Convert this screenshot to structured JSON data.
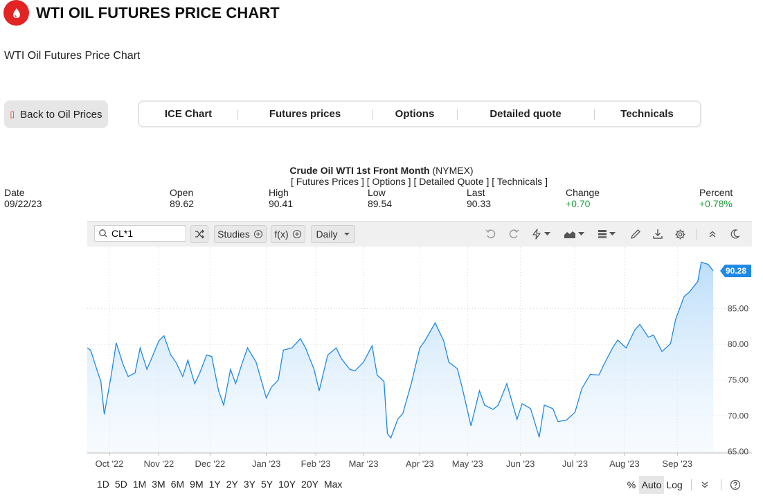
{
  "header": {
    "title": "WTI OIL FUTURES PRICE CHART",
    "subtitle": "WTI Oil Futures Price Chart",
    "logo_icon": "oil-drop-icon",
    "brand_color": "#e32424"
  },
  "back_button": {
    "label": "Back to Oil Prices",
    "icon": "back-box-icon"
  },
  "tabs": [
    {
      "label": "ICE Chart"
    },
    {
      "label": "Futures prices"
    },
    {
      "label": "Options"
    },
    {
      "label": "Detailed quote"
    },
    {
      "label": "Technicals"
    }
  ],
  "quote": {
    "name": "Crude Oil WTI 1st Front Month",
    "exchange": "(NYMEX)",
    "links": [
      "[ Futures Prices ]",
      "[ Options ]",
      "[ Detailed Quote ]",
      "[ Technicals ]"
    ],
    "columns": [
      {
        "label": "Date",
        "value": "09/22/23"
      },
      {
        "label": "Open",
        "value": "89.62"
      },
      {
        "label": "High",
        "value": "90.41"
      },
      {
        "label": "Low",
        "value": "89.54"
      },
      {
        "label": "Last",
        "value": "90.33"
      },
      {
        "label": "Change",
        "value": "+0.70"
      },
      {
        "label": "Percent",
        "value": "+0.78%"
      }
    ],
    "positive_color": "#1f9d3a"
  },
  "toolbar": {
    "search_value": "CL*1",
    "studies_label": "Studies",
    "fx_label": "f(x)",
    "interval_label": "Daily",
    "icons": [
      "search-icon",
      "shuffle-icon",
      "undo-icon",
      "redo-icon",
      "lightning-icon",
      "chart-type-icon",
      "layout-icon",
      "draw-pencil-icon",
      "download-icon",
      "settings-gear-icon",
      "collapse-up-icon",
      "dark-mode-moon-icon"
    ]
  },
  "ranges": [
    "1D",
    "5D",
    "1M",
    "3M",
    "6M",
    "9M",
    "1Y",
    "2Y",
    "3Y",
    "5Y",
    "10Y",
    "20Y",
    "Max"
  ],
  "scale_options": {
    "percent": "%",
    "auto": "Auto",
    "log": "Log"
  },
  "chart_data": {
    "type": "area",
    "title": "",
    "xlabel": "",
    "ylabel": "",
    "ylim": [
      64.8,
      93.0
    ],
    "yticks": [
      "65.00",
      "70.00",
      "75.00",
      "80.00",
      "85.00"
    ],
    "xticks": [
      {
        "label": "Oct '22",
        "date": "2022-10-03"
      },
      {
        "label": "Nov '22",
        "date": "2022-11-01"
      },
      {
        "label": "Dec '22",
        "date": "2022-12-01"
      },
      {
        "label": "Jan '23",
        "date": "2023-01-03"
      },
      {
        "label": "Feb '23",
        "date": "2023-02-01"
      },
      {
        "label": "Mar '23",
        "date": "2023-03-01"
      },
      {
        "label": "Apr '23",
        "date": "2023-04-03"
      },
      {
        "label": "May '23",
        "date": "2023-05-01"
      },
      {
        "label": "Jun '23",
        "date": "2023-06-01"
      },
      {
        "label": "Jul '23",
        "date": "2023-07-03"
      },
      {
        "label": "Aug '23",
        "date": "2023-08-01"
      },
      {
        "label": "Sep '23",
        "date": "2023-09-01"
      }
    ],
    "last_value_label": "90.28",
    "line_color": "#1e88e5",
    "fill_color": "#cfe6fb",
    "grid": true,
    "series": [
      {
        "x": [
          "2022-09-20",
          "2022-09-22",
          "2022-09-26",
          "2022-09-28",
          "2022-09-30",
          "2022-10-04",
          "2022-10-07",
          "2022-10-11",
          "2022-10-14",
          "2022-10-18",
          "2022-10-21",
          "2022-10-25",
          "2022-10-28",
          "2022-11-01",
          "2022-11-04",
          "2022-11-08",
          "2022-11-11",
          "2022-11-15",
          "2022-11-18",
          "2022-11-22",
          "2022-11-25",
          "2022-11-29",
          "2022-12-02",
          "2022-12-06",
          "2022-12-09",
          "2022-12-13",
          "2022-12-16",
          "2022-12-20",
          "2022-12-23",
          "2022-12-28",
          "2023-01-03",
          "2023-01-06",
          "2023-01-10",
          "2023-01-13",
          "2023-01-18",
          "2023-01-23",
          "2023-01-26",
          "2023-01-31",
          "2023-02-03",
          "2023-02-08",
          "2023-02-13",
          "2023-02-16",
          "2023-02-21",
          "2023-02-24",
          "2023-03-01",
          "2023-03-06",
          "2023-03-09",
          "2023-03-13",
          "2023-03-15",
          "2023-03-17",
          "2023-03-21",
          "2023-03-24",
          "2023-03-29",
          "2023-04-03",
          "2023-04-06",
          "2023-04-12",
          "2023-04-17",
          "2023-04-20",
          "2023-04-25",
          "2023-04-28",
          "2023-05-03",
          "2023-05-08",
          "2023-05-11",
          "2023-05-16",
          "2023-05-19",
          "2023-05-24",
          "2023-05-30",
          "2023-06-02",
          "2023-06-07",
          "2023-06-12",
          "2023-06-15",
          "2023-06-20",
          "2023-06-23",
          "2023-06-28",
          "2023-07-03",
          "2023-07-07",
          "2023-07-12",
          "2023-07-17",
          "2023-07-20",
          "2023-07-25",
          "2023-07-28",
          "2023-08-02",
          "2023-08-07",
          "2023-08-10",
          "2023-08-15",
          "2023-08-18",
          "2023-08-23",
          "2023-08-28",
          "2023-08-31",
          "2023-09-05",
          "2023-09-08",
          "2023-09-13",
          "2023-09-15",
          "2023-09-19",
          "2023-09-22"
        ],
        "values": [
          79.5,
          79.2,
          76.2,
          74.8,
          70.2,
          75.6,
          80.2,
          77.2,
          75.5,
          76.0,
          79.5,
          76.5,
          78.2,
          80.5,
          81.2,
          78.5,
          77.5,
          75.5,
          77.8,
          74.5,
          76.0,
          78.5,
          78.3,
          73.5,
          71.5,
          76.5,
          74.5,
          77.5,
          79.5,
          77.5,
          72.5,
          74.0,
          75.0,
          79.2,
          79.5,
          80.8,
          79.5,
          76.5,
          73.5,
          78.5,
          79.5,
          78.0,
          76.5,
          76.3,
          77.5,
          79.8,
          75.7,
          74.8,
          67.5,
          66.9,
          69.5,
          70.3,
          74.5,
          79.5,
          80.5,
          83.0,
          80.5,
          77.5,
          76.6,
          73.8,
          68.6,
          73.5,
          71.5,
          70.9,
          71.5,
          74.5,
          69.5,
          71.7,
          71.0,
          67.0,
          71.5,
          71.0,
          69.2,
          69.4,
          70.5,
          73.8,
          75.8,
          75.7,
          77.2,
          79.5,
          80.6,
          79.5,
          82.0,
          82.8,
          81.0,
          81.3,
          79.0,
          80.1,
          83.5,
          86.7,
          87.3,
          88.8,
          91.5,
          91.2,
          90.3
        ]
      }
    ]
  }
}
